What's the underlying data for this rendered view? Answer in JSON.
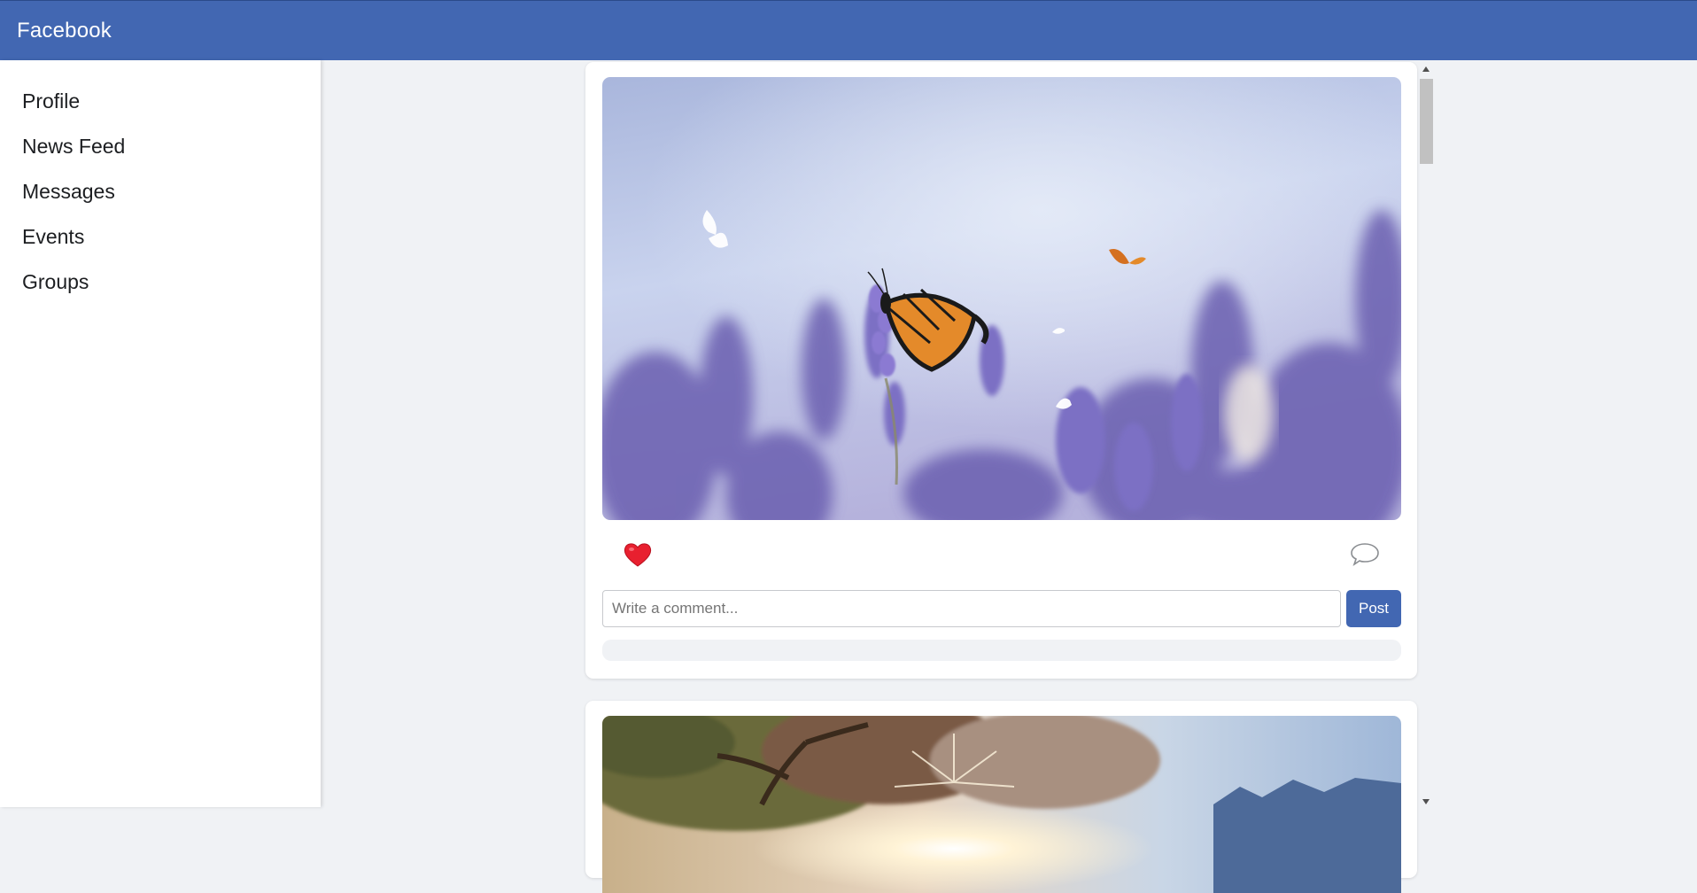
{
  "app": {
    "title": "Facebook",
    "accent": "#4267b2"
  },
  "sidebar": {
    "items": [
      {
        "label": "Profile"
      },
      {
        "label": "News Feed"
      },
      {
        "label": "Messages"
      },
      {
        "label": "Events"
      },
      {
        "label": "Groups"
      }
    ]
  },
  "feed": {
    "posts": [
      {
        "image": "butterfly-lavender-photo",
        "comment_placeholder": "Write a comment...",
        "post_label": "Post"
      },
      {
        "image": "tree-sunburst-photo"
      }
    ]
  }
}
